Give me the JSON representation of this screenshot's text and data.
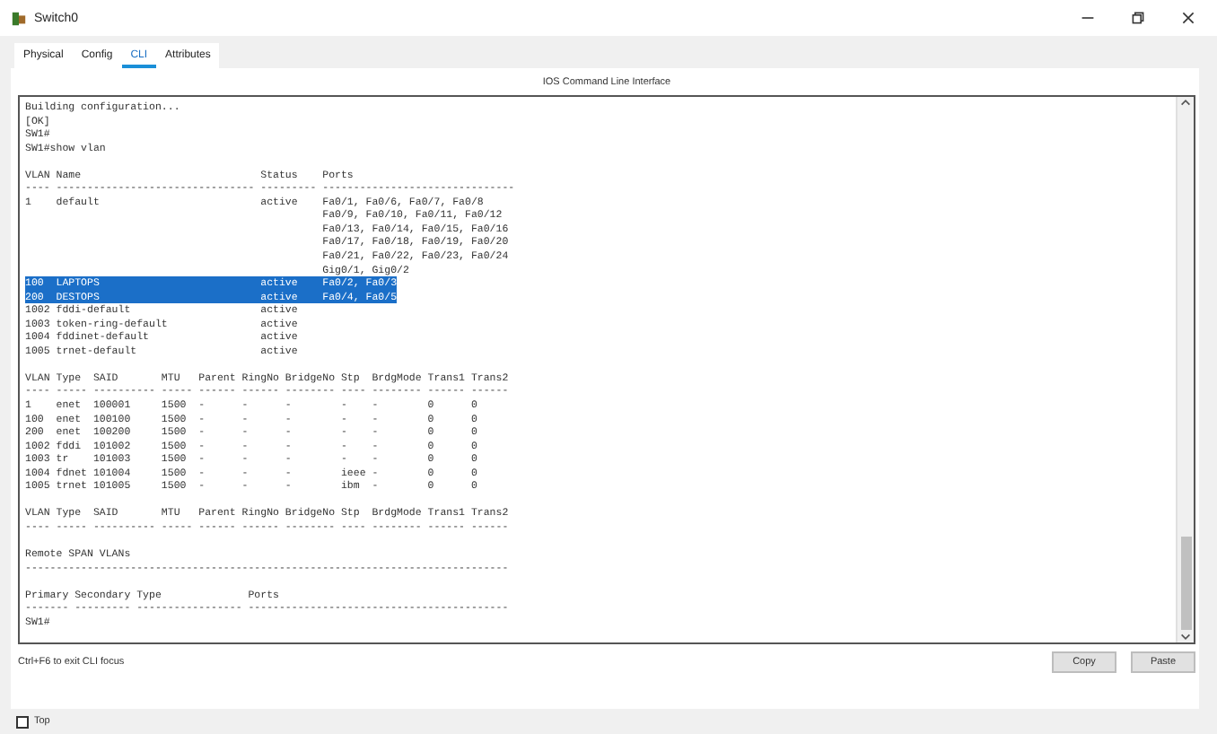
{
  "window": {
    "title": "Switch0"
  },
  "tabs": [
    {
      "label": "Physical",
      "selected": false
    },
    {
      "label": "Config",
      "selected": false
    },
    {
      "label": "CLI",
      "selected": true
    },
    {
      "label": "Attributes",
      "selected": false
    }
  ],
  "panel_title": "IOS Command Line Interface",
  "terminal": {
    "lines": [
      {
        "kind": "text",
        "text": "Building configuration...",
        "selected": false
      },
      {
        "kind": "text",
        "text": "[OK]",
        "selected": false
      },
      {
        "kind": "text",
        "text": "SW1#",
        "selected": false
      },
      {
        "kind": "text",
        "text": "SW1#show vlan",
        "selected": false
      },
      {
        "kind": "blank"
      },
      {
        "kind": "text",
        "text": "VLAN Name                             Status    Ports",
        "selected": false
      },
      {
        "kind": "text",
        "text": "---- -------------------------------- --------- -------------------------------",
        "selected": false
      },
      {
        "kind": "text",
        "text": "1    default                          active    Fa0/1, Fa0/6, Fa0/7, Fa0/8",
        "selected": false
      },
      {
        "kind": "text",
        "text": "                                                Fa0/9, Fa0/10, Fa0/11, Fa0/12",
        "selected": false
      },
      {
        "kind": "text",
        "text": "                                                Fa0/13, Fa0/14, Fa0/15, Fa0/16",
        "selected": false
      },
      {
        "kind": "text",
        "text": "                                                Fa0/17, Fa0/18, Fa0/19, Fa0/20",
        "selected": false
      },
      {
        "kind": "text",
        "text": "                                                Fa0/21, Fa0/22, Fa0/23, Fa0/24",
        "selected": false
      },
      {
        "kind": "text",
        "text": "                                                Gig0/1, Gig0/2",
        "selected": false
      },
      {
        "kind": "text",
        "text": "100  LAPTOPS                          active    Fa0/2, Fa0/3",
        "selected": true
      },
      {
        "kind": "text",
        "text": "200  DESTOPS                          active    Fa0/4, Fa0/5",
        "selected": true
      },
      {
        "kind": "text",
        "text": "1002 fddi-default                     active",
        "selected": false
      },
      {
        "kind": "text",
        "text": "1003 token-ring-default               active",
        "selected": false
      },
      {
        "kind": "text",
        "text": "1004 fddinet-default                  active",
        "selected": false
      },
      {
        "kind": "text",
        "text": "1005 trnet-default                    active",
        "selected": false
      },
      {
        "kind": "blank"
      },
      {
        "kind": "text",
        "text": "VLAN Type  SAID       MTU   Parent RingNo BridgeNo Stp  BrdgMode Trans1 Trans2",
        "selected": false
      },
      {
        "kind": "text",
        "text": "---- ----- ---------- ----- ------ ------ -------- ---- -------- ------ ------",
        "selected": false
      },
      {
        "kind": "text",
        "text": "1    enet  100001     1500  -      -      -        -    -        0      0",
        "selected": false
      },
      {
        "kind": "text",
        "text": "100  enet  100100     1500  -      -      -        -    -        0      0",
        "selected": false
      },
      {
        "kind": "text",
        "text": "200  enet  100200     1500  -      -      -        -    -        0      0",
        "selected": false
      },
      {
        "kind": "text",
        "text": "1002 fddi  101002     1500  -      -      -        -    -        0      0",
        "selected": false
      },
      {
        "kind": "text",
        "text": "1003 tr    101003     1500  -      -      -        -    -        0      0",
        "selected": false
      },
      {
        "kind": "text",
        "text": "1004 fdnet 101004     1500  -      -      -        ieee -        0      0",
        "selected": false
      },
      {
        "kind": "text",
        "text": "1005 trnet 101005     1500  -      -      -        ibm  -        0      0",
        "selected": false
      },
      {
        "kind": "blank"
      },
      {
        "kind": "text",
        "text": "VLAN Type  SAID       MTU   Parent RingNo BridgeNo Stp  BrdgMode Trans1 Trans2",
        "selected": false
      },
      {
        "kind": "text",
        "text": "---- ----- ---------- ----- ------ ------ -------- ---- -------- ------ ------",
        "selected": false
      },
      {
        "kind": "blank"
      },
      {
        "kind": "text",
        "text": "Remote SPAN VLANs",
        "selected": false
      },
      {
        "kind": "text",
        "text": "------------------------------------------------------------------------------",
        "selected": false
      },
      {
        "kind": "blank"
      },
      {
        "kind": "text",
        "text": "Primary Secondary Type              Ports",
        "selected": false
      },
      {
        "kind": "text",
        "text": "------- --------- ----------------- ------------------------------------------",
        "selected": false
      },
      {
        "kind": "text",
        "text": "SW1#",
        "selected": false
      }
    ]
  },
  "hint": "Ctrl+F6 to exit CLI focus",
  "buttons": [
    "Copy",
    "Paste"
  ],
  "top_checkbox": {
    "label": "Top",
    "checked": false
  }
}
